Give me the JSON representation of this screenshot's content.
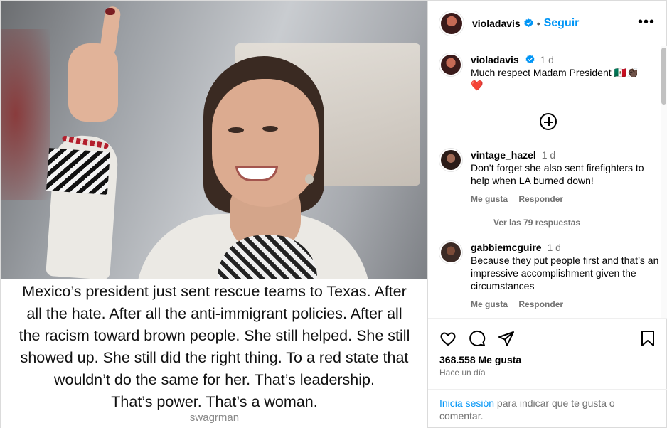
{
  "post": {
    "caption_lines": [
      "Mexico’s president just sent rescue teams to Texas. After",
      "all the hate. After all the anti-immigrant policies. After all",
      "the racism toward brown people. She still helped. She still",
      "showed up. She still did the right thing. To a red state that",
      "wouldn’t do the same for her. That’s leadership.",
      "That’s power. That’s a woman."
    ],
    "watermark": "swagrman"
  },
  "header": {
    "username": "violadavis",
    "separator": "•",
    "follow_label": "Seguir",
    "more_label": "•••"
  },
  "comments": [
    {
      "username": "violadavis",
      "time": "1 d",
      "text": "Much respect Madam President 🇲🇽👏🏿",
      "text2": "❤️"
    },
    {
      "username": "vintage_hazel",
      "time": "1 d",
      "text": "Don’t forget she also sent firefighters to help when LA burned down!",
      "like_label": "Me gusta",
      "reply_label": "Responder"
    },
    {
      "username": "gabbiemcguire",
      "time": "1 d",
      "text": "Because they put people first and that’s an impressive accomplishment given the circumstances",
      "like_label": "Me gusta",
      "reply_label": "Responder"
    }
  ],
  "view_replies": "Ver las 79 respuestas",
  "actions": {
    "icons": [
      "heart-icon",
      "comment-icon",
      "share-icon",
      "bookmark-icon"
    ]
  },
  "likes": "368.558 Me gusta",
  "time_ago": "Hace un día",
  "login_prompt": {
    "link": "Inicia sesión",
    "text": " para indicar que te gusta o comentar."
  },
  "colors": {
    "accent": "#0095f6",
    "muted": "#737373",
    "verified": "#0095f6"
  }
}
